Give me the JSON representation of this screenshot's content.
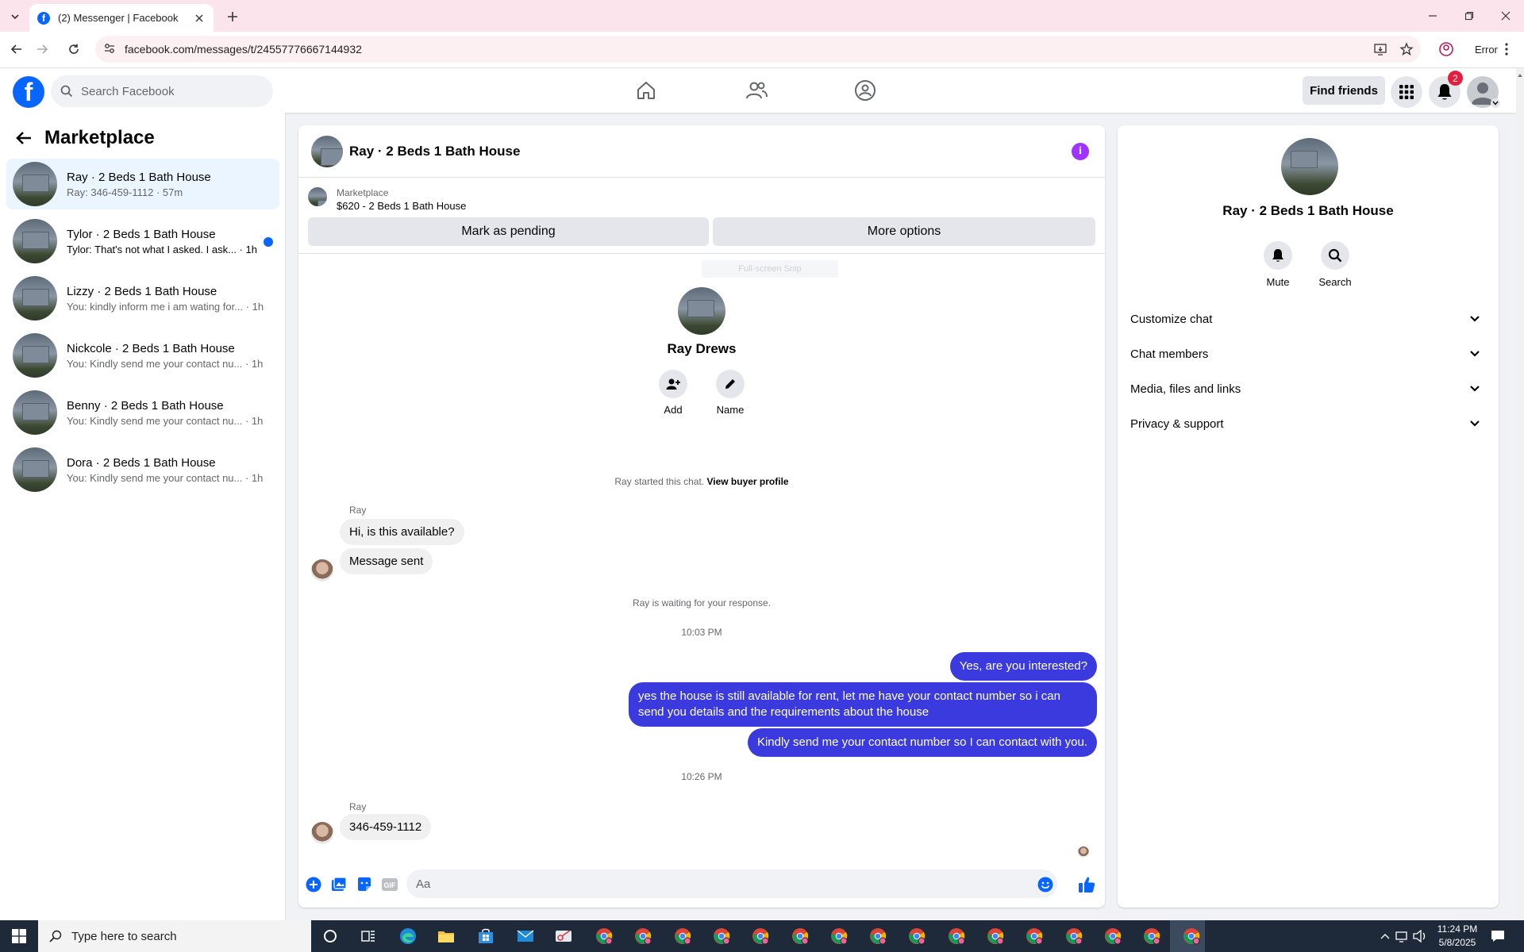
{
  "browser": {
    "tab_title": "(2) Messenger | Facebook",
    "url": "facebook.com/messages/t/24557776667144932",
    "profile_label": "Error"
  },
  "fb_header": {
    "search_placeholder": "Search Facebook",
    "find_friends": "Find friends",
    "notification_count": "2"
  },
  "sidebar": {
    "title": "Marketplace",
    "threads": [
      {
        "name": "Ray · 2 Beds 1 Bath House",
        "preview": "Ray: 346-459-1112 · 57m",
        "active": true,
        "unread": false
      },
      {
        "name": "Tylor · 2 Beds 1 Bath House",
        "preview": "Tylor: That's not what I asked. I ask... · 1h",
        "active": false,
        "unread": true
      },
      {
        "name": "Lizzy · 2 Beds 1 Bath House",
        "preview": "You: kindly inform me i am wating for... · 1h",
        "active": false,
        "unread": false
      },
      {
        "name": "Nickcole · 2 Beds 1 Bath House",
        "preview": "You: Kindly send me your contact nu... · 1h",
        "active": false,
        "unread": false
      },
      {
        "name": "Benny · 2 Beds 1 Bath House",
        "preview": "You: Kindly send me your contact nu... · 1h",
        "active": false,
        "unread": false
      },
      {
        "name": "Dora · 2 Beds 1 Bath House",
        "preview": "You: Kindly send me your contact nu... · 1h",
        "active": false,
        "unread": false
      }
    ]
  },
  "chat": {
    "title": "Ray · 2 Beds 1 Bath House",
    "listing": {
      "label": "Marketplace",
      "price_title": "$620 - 2 Beds 1 Bath House",
      "pending_button": "Mark as pending",
      "more_button": "More options"
    },
    "snip_hint": "Full-screen Snip",
    "intro": {
      "name": "Ray Drews",
      "add_label": "Add",
      "name_label": "Name"
    },
    "started_text": "Ray started this chat.",
    "view_profile": "View buyer profile",
    "sender_1": "Ray",
    "msg_in_1": "Hi, is this available?",
    "msg_in_2": "Message sent",
    "waiting_text": "Ray is waiting for your response.",
    "time_1": "10:03 PM",
    "msg_out_1": "Yes, are you interested?",
    "msg_out_2": "yes the house is still available for rent, let me have your contact number so i can send you details and the requirements about the house",
    "msg_out_3": "Kindly send me your contact number so I can contact with you.",
    "time_2": "10:26 PM",
    "sender_2": "Ray",
    "msg_in_3": "346-459-1112",
    "composer_placeholder": "Aa"
  },
  "details": {
    "name": "Ray · 2 Beds 1 Bath House",
    "mute_label": "Mute",
    "search_label": "Search",
    "sections": [
      "Customize chat",
      "Chat members",
      "Media, files and links",
      "Privacy & support"
    ]
  },
  "taskbar": {
    "search_placeholder": "Type here to search",
    "time": "11:24 PM",
    "date": "5/8/2025"
  },
  "colors": {
    "fb_blue": "#0866ff",
    "outgoing_bubble": "#3a3adf",
    "info_purple": "#a033ff",
    "tab_strip": "#fce4ec"
  }
}
